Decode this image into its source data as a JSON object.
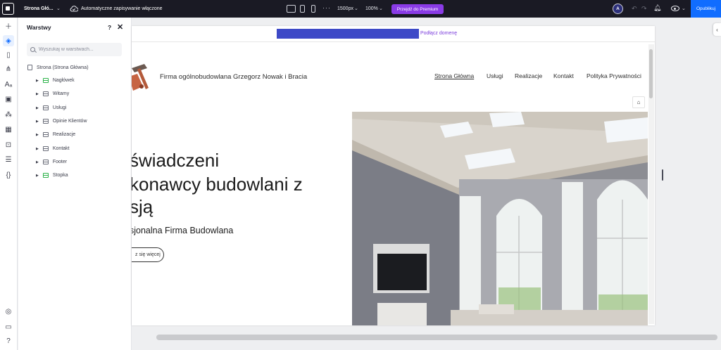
{
  "topbar": {
    "site_name": "Strona Głó...",
    "autosave_text": "Automatyczne zapisywanie włączone",
    "width_value": "1500px",
    "zoom_value": "100%",
    "premium_label": "Przejdź do Premium",
    "avatar_initial": "A",
    "publish_label": "Opublikuj",
    "accent_color": "#116dff",
    "premium_color": "#8a3be6"
  },
  "rail": {
    "icons": [
      "add-icon",
      "layers-icon",
      "pages-icon",
      "sitemap-icon",
      "text-theme-icon",
      "media-icon",
      "apps-icon",
      "widgets-icon",
      "business-icon",
      "cms-icon",
      "code-icon",
      "checklist-icon",
      "chat-icon",
      "help-icon"
    ]
  },
  "layers_panel": {
    "title": "Warstwy",
    "help_label": "?",
    "close_label": "✕",
    "search_placeholder": "Wyszukaj w warstwach...",
    "root_label": "Strona (Strona Główna)",
    "items": [
      {
        "label": "Nagłówek"
      },
      {
        "label": "Witamy"
      },
      {
        "label": "Usługi"
      },
      {
        "label": "Opinie Klientów"
      },
      {
        "label": "Realizacje"
      },
      {
        "label": "Kontakt"
      },
      {
        "label": "Footer"
      },
      {
        "label": "Stopka"
      }
    ]
  },
  "canvas": {
    "domain_link": "Podłącz domenę",
    "company_name": "Firma ogólnobudowlana Grzegorz Nowak i Bracia",
    "nav": [
      "Strona Główna",
      "Usługi",
      "Realizacje",
      "Kontakt",
      "Polityka Prywatności"
    ],
    "hero_line1": "świadczeni",
    "hero_line2": "konawcy budowlani z",
    "hero_line3": "sją",
    "hero_subtitle": "sjonalna Firma Budowlana",
    "hero_button": "z się więcej"
  }
}
